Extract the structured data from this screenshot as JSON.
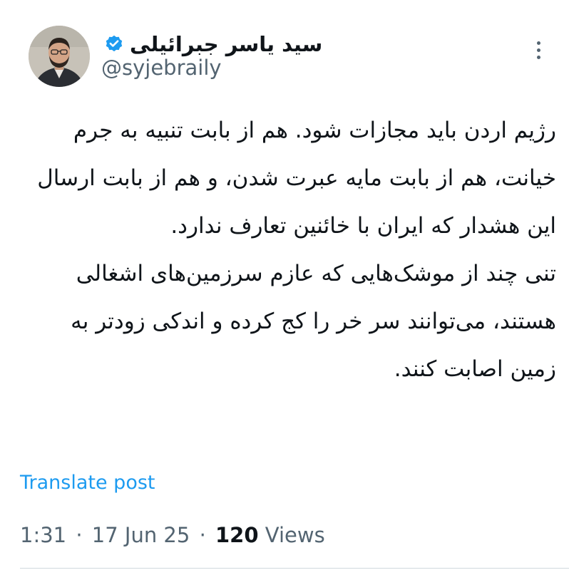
{
  "author": {
    "name": "سید یاسر جبرائیلی",
    "handle": "@syjebraily",
    "verified": true,
    "verified_color": "#1d9bf0"
  },
  "post": {
    "paragraphs": [
      "رژیم اردن باید مجازات شود. هم از بابت تنبیه  به جرم خیانت، هم از بابت مایه عبرت شدن، و هم از بابت ارسال این هشدار که ایران با خائنین تعارف ندارد.",
      "تنی چند از موشک‌هایی که عازم سرزمین‌های اشغالی هستند، می‌توانند سر خر را کج کرده و اندکی زودتر به زمین اصابت کنند."
    ]
  },
  "translate_label": "Translate post",
  "meta": {
    "time": "1:31",
    "separator": "·",
    "date": "17 Jun 25",
    "views_count": "120",
    "views_label": "Views"
  },
  "icons": {
    "verified": "verified-badge-icon",
    "more": "more-options-icon"
  },
  "colors": {
    "text": "#0f1419",
    "secondary": "#536471",
    "link": "#1d9bf0"
  }
}
